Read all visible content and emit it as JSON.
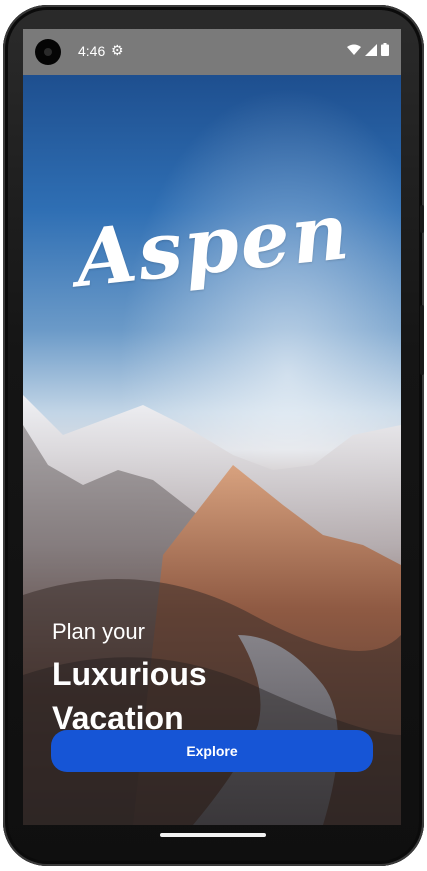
{
  "status_bar": {
    "time": "4:46",
    "settings_icon": "gear-icon",
    "wifi_icon": "wifi-icon",
    "signal_icon": "signal-icon",
    "battery_icon": "battery-icon"
  },
  "brand": {
    "name": "Aspen"
  },
  "hero": {
    "tagline": "Plan your",
    "headline_line1": "Luxurious",
    "headline_line2": "Vacation"
  },
  "cta": {
    "label": "Explore",
    "color": "#1655d6"
  }
}
